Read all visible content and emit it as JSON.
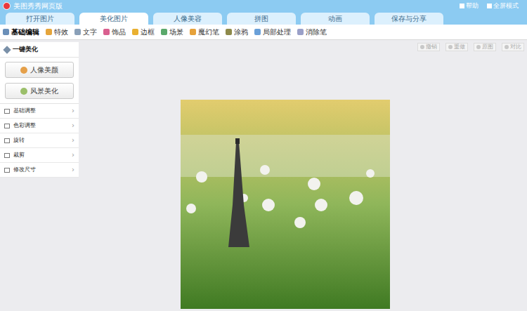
{
  "window": {
    "title": "美图秀秀网页版",
    "actions": [
      "帮助",
      "全屏模式"
    ]
  },
  "tabs": [
    {
      "label": "打开图片",
      "selected": false
    },
    {
      "label": "美化图片",
      "selected": true
    },
    {
      "label": "人像美容",
      "selected": false
    },
    {
      "label": "拼图",
      "selected": false
    },
    {
      "label": "动画",
      "selected": false
    },
    {
      "label": "保存与分享",
      "selected": false
    }
  ],
  "toolbar": [
    {
      "label": "基础编辑",
      "selected": true
    },
    {
      "label": "特效",
      "selected": false
    },
    {
      "label": "文字",
      "selected": false
    },
    {
      "label": "饰品",
      "selected": false
    },
    {
      "label": "边框",
      "selected": false
    },
    {
      "label": "场景",
      "selected": false
    },
    {
      "label": "魔幻笔",
      "selected": false
    },
    {
      "label": "涂鸦",
      "selected": false
    },
    {
      "label": "局部处理",
      "selected": false
    },
    {
      "label": "消除笔",
      "selected": false
    }
  ],
  "history_buttons": [
    {
      "label": "撤销",
      "disabled": true
    },
    {
      "label": "重做",
      "disabled": true
    },
    {
      "label": "原图",
      "disabled": true
    },
    {
      "label": "对比",
      "disabled": true
    }
  ],
  "sidebar": {
    "header": "一键美化",
    "buttons": [
      "人像美颜",
      "风景美化"
    ],
    "items": [
      "基础调整",
      "色彩调整",
      "旋转",
      "裁剪",
      "修改尺寸"
    ],
    "arrow": "›"
  }
}
